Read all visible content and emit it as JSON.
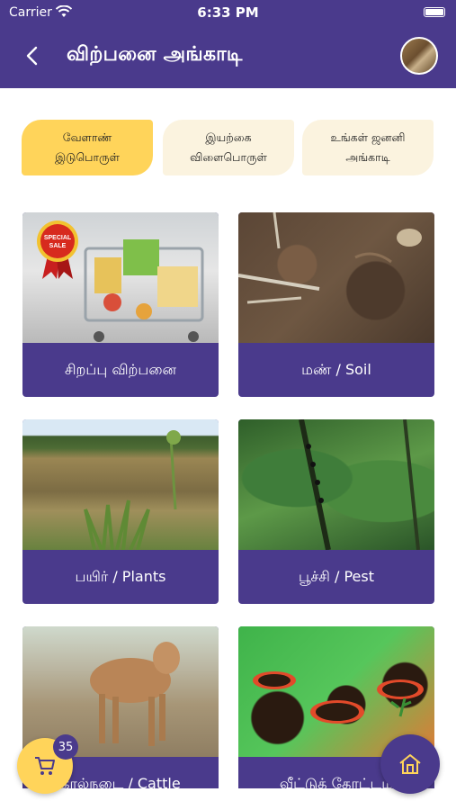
{
  "status_bar": {
    "carrier": "Carrier",
    "time": "6:33 PM"
  },
  "header": {
    "title": "விற்பனை அங்காடி",
    "back_icon": "chevron-left-icon",
    "avatar": "user-avatar"
  },
  "tabs": [
    {
      "label": "வேளாண்\nஇடுபொருள்",
      "active": true
    },
    {
      "label": "இயற்கை\nவிளைபொருள்",
      "active": false
    },
    {
      "label": "உங்கள் ஜனனி\nஅங்காடி",
      "active": false
    }
  ],
  "categories": [
    {
      "label": "சிறப்பு விற்பனை",
      "badge_text": "SPECIAL SALE"
    },
    {
      "label": "மண் / Soil"
    },
    {
      "label": "பயிர் / Plants"
    },
    {
      "label": "பூச்சி / Pest"
    },
    {
      "label": "கால்நடை / Cattle"
    },
    {
      "label": "வீட்டுத் தோட்டம்"
    }
  ],
  "cart": {
    "count": "35",
    "icon": "cart-icon"
  },
  "home": {
    "icon": "home-icon"
  },
  "colors": {
    "primary": "#4a3a8c",
    "accent": "#ffd45a",
    "tab_bg": "#fbf3df"
  }
}
